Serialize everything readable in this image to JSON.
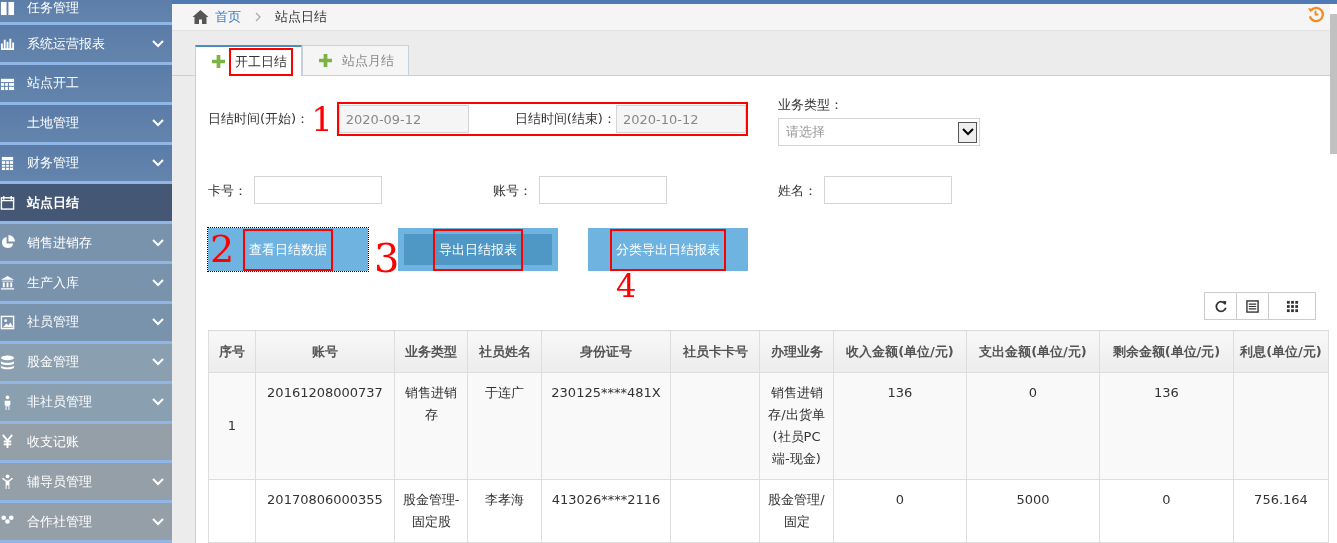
{
  "sidebar": {
    "items": [
      {
        "label": "任务管理",
        "has_submenu": false,
        "selected": false
      },
      {
        "label": "系统运营报表",
        "has_submenu": true,
        "selected": false
      },
      {
        "label": "站点开工",
        "has_submenu": false,
        "selected": false
      },
      {
        "label": "土地管理",
        "has_submenu": true,
        "selected": false
      },
      {
        "label": "财务管理",
        "has_submenu": true,
        "selected": false
      },
      {
        "label": "站点日结",
        "has_submenu": false,
        "selected": true
      },
      {
        "label": "销售进销存",
        "has_submenu": true,
        "selected": false
      },
      {
        "label": "生产入库",
        "has_submenu": true,
        "selected": false
      },
      {
        "label": "社员管理",
        "has_submenu": true,
        "selected": false
      },
      {
        "label": "股金管理",
        "has_submenu": true,
        "selected": false
      },
      {
        "label": "非社员管理",
        "has_submenu": true,
        "selected": false
      },
      {
        "label": "收支记账",
        "has_submenu": false,
        "selected": false
      },
      {
        "label": "辅导员管理",
        "has_submenu": true,
        "selected": false
      },
      {
        "label": "合作社管理",
        "has_submenu": true,
        "selected": false
      }
    ]
  },
  "breadcrumb": {
    "home": "首页",
    "current": "站点日结"
  },
  "tabs": [
    {
      "label": "开工日结",
      "selected": true,
      "annotated": true
    },
    {
      "label": "站点月结",
      "selected": false,
      "annotated": false
    }
  ],
  "filters": {
    "date_range": {
      "annotated": true,
      "annotation_mark": "1",
      "start": {
        "label": "日结时间(开始)：",
        "value": "2020-09-12"
      },
      "end": {
        "label": "日结时间(结束)：",
        "value": "2020-10-12"
      }
    },
    "business_type": {
      "label": "业务类型：",
      "placeholder": "请选择"
    },
    "card_no": {
      "label": "卡号："
    },
    "account_no": {
      "label": "账号："
    },
    "name": {
      "label": "姓名："
    }
  },
  "buttons": [
    {
      "label": "查看日结数据",
      "annotated": true,
      "annotation_mark": "2",
      "focused": true,
      "hovered": false
    },
    {
      "label": "导出日结报表",
      "annotated": true,
      "annotation_mark": "3",
      "focused": false,
      "hovered": true
    },
    {
      "label": "分类导出日结报表",
      "annotated": true,
      "annotation_mark": "4",
      "focused": false,
      "hovered": false
    }
  ],
  "table": {
    "columns": [
      "序号",
      "账号",
      "业务类型",
      "社员姓名",
      "身份证号",
      "社员卡卡号",
      "办理业务",
      "收入金额(单位/元)",
      "支出金额(单位/元)",
      "剩余金额(单位/元)",
      "利息(单位/元)"
    ],
    "rows": [
      {
        "cells": [
          "1",
          "20161208000737",
          "销售进销存",
          "于连广",
          "230125****481X",
          null,
          "销售进销存/出货单(社员PC端-现金)",
          "136",
          "0",
          "136",
          null
        ]
      },
      {
        "cells": [
          null,
          "20170806000355",
          "股金管理-固定股",
          "李孝海",
          "413026****2116",
          null,
          "股金管理/固定",
          "0",
          "5000",
          "0",
          "756.164"
        ]
      }
    ]
  }
}
